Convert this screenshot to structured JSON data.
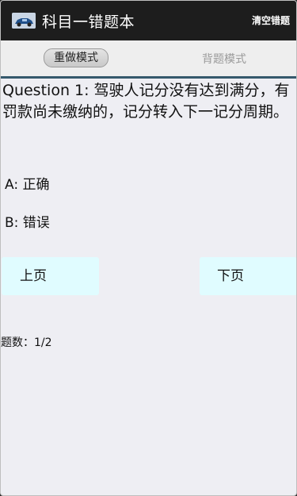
{
  "header": {
    "title": "科目一错题本",
    "clear_label": "清空错题"
  },
  "tabs": [
    {
      "label": "重做模式",
      "selected": true
    },
    {
      "label": "背题模式",
      "selected": false
    }
  ],
  "question": {
    "text": "Question 1:  驾驶人记分没有达到满分，有罚款尚未缴纳的，记分转入下一记分周期。",
    "options": [
      {
        "label": "A:  正确"
      },
      {
        "label": "B:  错误"
      }
    ]
  },
  "navigation": {
    "prev_label": "上页",
    "next_label": "下页"
  },
  "footer": {
    "count_label": "题数：",
    "count_value": "1/2"
  },
  "colors": {
    "titlebar": "#1d1d1d",
    "accent_line": "#35596c",
    "button_bg": "#e0fcff",
    "page_bg": "#eeeef3"
  }
}
